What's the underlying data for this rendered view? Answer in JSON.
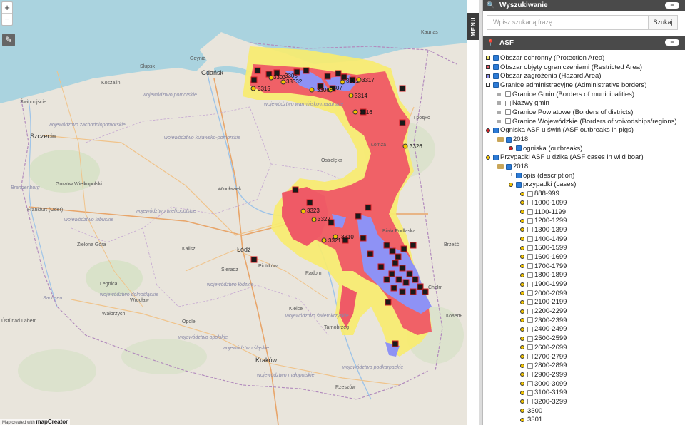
{
  "map": {
    "zoom_in": "+",
    "zoom_out": "−",
    "credit_prefix": "Map created with",
    "credit_brand": "mapCreator",
    "cities": [
      "Gdańsk",
      "Szczecin",
      "Łódź",
      "Kraków",
      "Radom",
      "Ostrołęka",
      "Włocławek",
      "Kalisz",
      "Frankfurt (Oder)",
      "Gorzów Wielkopolski",
      "Zielona Góra",
      "Koszalin",
      "Słupsk",
      "Gdynia",
      "Świnoujście",
      "Wrocław",
      "Opole",
      "Tarnobrzeg",
      "Biała Podlaska",
      "Гродно",
      "Ústí nad Labem",
      "Wałbrzych",
      "Legnica",
      "Kielce",
      "Piotrków",
      "Sieradz",
      "Brześć",
      "Ковель",
      "Łomża",
      "Chełm",
      "Rzeszów",
      "Kaunas"
    ],
    "regions": [
      "województwo pomorskie",
      "województwo zachodniopomorskie",
      "województwo warmińsko-mazurskie",
      "województwo kujawsko-pomorskie",
      "województwo lubuskie",
      "województwo wielkopolskie",
      "województwo łódzkie",
      "województwo dolnośląskie",
      "województwo opolskie",
      "województwo śląskie",
      "województwo małopolskie",
      "województwo podkarpackie",
      "województwo świętokrzyskie",
      "Sachsen",
      "Brandenburg"
    ],
    "case_labels": [
      "3303",
      "3305",
      "33332",
      "3315",
      "3306",
      "3307",
      "3301",
      "3317",
      "3314",
      "3316",
      "3326",
      "3323",
      "3322",
      "3321",
      "3310"
    ],
    "colors": {
      "protection": "#f7ec6f",
      "restricted": "#ef5a66",
      "hazard": "#8e92f5",
      "outbreak": "#d31e25",
      "case": "#f2c400"
    }
  },
  "menu_tab": "MENU",
  "search": {
    "title": "Wyszukiwanie",
    "placeholder": "Wpisz szukaną frazę",
    "button": "Szukaj",
    "collapse": "−"
  },
  "asf": {
    "title": "ASF",
    "collapse": "−",
    "zones": [
      {
        "label": "Obszar ochronny (Protection Area)",
        "color": "#f7ec6f"
      },
      {
        "label": "Obszar objęty ograniczeniami (Restricted Area)",
        "color": "#ef5a66"
      },
      {
        "label": "Obszar zagrożenia (Hazard Area)",
        "color": "#8e92f5"
      },
      {
        "label": "Granice administracyjne (Administrative borders)",
        "color": "#ffffff"
      }
    ],
    "borders": [
      "Granice Gmin (Borders of municipalities)",
      "Nazwy gmin",
      "Granice Powiatowe (Borders of districts)",
      "Granice Wojewódzkie (Borders of voivodships/regions)"
    ],
    "pigs": {
      "label": "Ogniska ASF u świń (ASF outbreaks in pigs)",
      "year": "2018",
      "sub": "ogniska (outbreaks)"
    },
    "boar": {
      "label": "Przypadki ASF u dzika (ASF cases in wild boar)",
      "year": "2018",
      "desc": "opis (description)",
      "cases": "przypadki (cases)",
      "ranges": [
        "888-999",
        "1000-1099",
        "1100-1199",
        "1200-1299",
        "1300-1399",
        "1400-1499",
        "1500-1599",
        "1600-1699",
        "1700-1799",
        "1800-1899",
        "1900-1999",
        "2000-2099",
        "2100-2199",
        "2200-2299",
        "2300-2399",
        "2400-2499",
        "2500-2599",
        "2600-2699",
        "2700-2799",
        "2800-2899",
        "2900-2999",
        "3000-3099",
        "3100-3199",
        "3200-3299"
      ],
      "singles": [
        "3300",
        "3301"
      ]
    }
  }
}
